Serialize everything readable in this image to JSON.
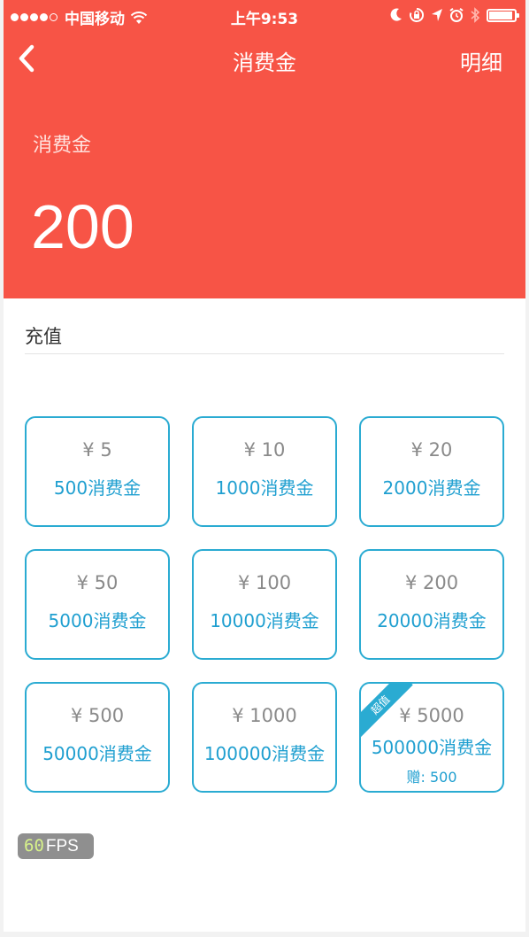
{
  "status": {
    "carrier": "中国移动",
    "time": "上午9:53"
  },
  "nav": {
    "title": "消费金",
    "right": "明细"
  },
  "balance": {
    "label": "消费金",
    "value": "200"
  },
  "section": {
    "title": "充值"
  },
  "packages": [
    {
      "price": "¥ 5",
      "amount": "500消费金"
    },
    {
      "price": "¥ 10",
      "amount": "1000消费金"
    },
    {
      "price": "¥ 20",
      "amount": "2000消费金"
    },
    {
      "price": "¥ 50",
      "amount": "5000消费金"
    },
    {
      "price": "¥ 100",
      "amount": "10000消费金"
    },
    {
      "price": "¥ 200",
      "amount": "20000消费金"
    },
    {
      "price": "¥ 500",
      "amount": "50000消费金"
    },
    {
      "price": "¥ 1000",
      "amount": "100000消费金"
    },
    {
      "price": "¥ 5000",
      "amount": "500000消费金",
      "bonus": "赠: 500",
      "tag": "超值"
    }
  ],
  "fps": {
    "value": "60",
    "label": "FPS"
  },
  "colors": {
    "header": "#f75446",
    "accent": "#2aabd2",
    "accent_text": "#1f9fd0"
  },
  "icons": [
    "signal-dots-icon",
    "wifi-icon",
    "moon-icon",
    "rotation-lock-icon",
    "location-arrow-icon",
    "alarm-icon",
    "bluetooth-icon",
    "battery-icon",
    "back-chevron-icon"
  ]
}
